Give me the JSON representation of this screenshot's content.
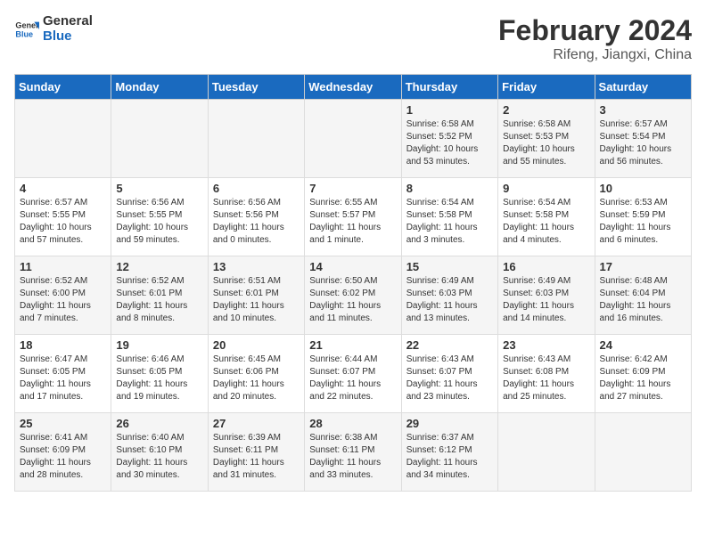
{
  "logo": {
    "line1": "General",
    "line2": "Blue"
  },
  "title": "February 2024",
  "subtitle": "Rifeng, Jiangxi, China",
  "days_of_week": [
    "Sunday",
    "Monday",
    "Tuesday",
    "Wednesday",
    "Thursday",
    "Friday",
    "Saturday"
  ],
  "weeks": [
    [
      {
        "day": "",
        "info": ""
      },
      {
        "day": "",
        "info": ""
      },
      {
        "day": "",
        "info": ""
      },
      {
        "day": "",
        "info": ""
      },
      {
        "day": "1",
        "info": "Sunrise: 6:58 AM\nSunset: 5:52 PM\nDaylight: 10 hours and 53 minutes."
      },
      {
        "day": "2",
        "info": "Sunrise: 6:58 AM\nSunset: 5:53 PM\nDaylight: 10 hours and 55 minutes."
      },
      {
        "day": "3",
        "info": "Sunrise: 6:57 AM\nSunset: 5:54 PM\nDaylight: 10 hours and 56 minutes."
      }
    ],
    [
      {
        "day": "4",
        "info": "Sunrise: 6:57 AM\nSunset: 5:55 PM\nDaylight: 10 hours and 57 minutes."
      },
      {
        "day": "5",
        "info": "Sunrise: 6:56 AM\nSunset: 5:55 PM\nDaylight: 10 hours and 59 minutes."
      },
      {
        "day": "6",
        "info": "Sunrise: 6:56 AM\nSunset: 5:56 PM\nDaylight: 11 hours and 0 minutes."
      },
      {
        "day": "7",
        "info": "Sunrise: 6:55 AM\nSunset: 5:57 PM\nDaylight: 11 hours and 1 minute."
      },
      {
        "day": "8",
        "info": "Sunrise: 6:54 AM\nSunset: 5:58 PM\nDaylight: 11 hours and 3 minutes."
      },
      {
        "day": "9",
        "info": "Sunrise: 6:54 AM\nSunset: 5:58 PM\nDaylight: 11 hours and 4 minutes."
      },
      {
        "day": "10",
        "info": "Sunrise: 6:53 AM\nSunset: 5:59 PM\nDaylight: 11 hours and 6 minutes."
      }
    ],
    [
      {
        "day": "11",
        "info": "Sunrise: 6:52 AM\nSunset: 6:00 PM\nDaylight: 11 hours and 7 minutes."
      },
      {
        "day": "12",
        "info": "Sunrise: 6:52 AM\nSunset: 6:01 PM\nDaylight: 11 hours and 8 minutes."
      },
      {
        "day": "13",
        "info": "Sunrise: 6:51 AM\nSunset: 6:01 PM\nDaylight: 11 hours and 10 minutes."
      },
      {
        "day": "14",
        "info": "Sunrise: 6:50 AM\nSunset: 6:02 PM\nDaylight: 11 hours and 11 minutes."
      },
      {
        "day": "15",
        "info": "Sunrise: 6:49 AM\nSunset: 6:03 PM\nDaylight: 11 hours and 13 minutes."
      },
      {
        "day": "16",
        "info": "Sunrise: 6:49 AM\nSunset: 6:03 PM\nDaylight: 11 hours and 14 minutes."
      },
      {
        "day": "17",
        "info": "Sunrise: 6:48 AM\nSunset: 6:04 PM\nDaylight: 11 hours and 16 minutes."
      }
    ],
    [
      {
        "day": "18",
        "info": "Sunrise: 6:47 AM\nSunset: 6:05 PM\nDaylight: 11 hours and 17 minutes."
      },
      {
        "day": "19",
        "info": "Sunrise: 6:46 AM\nSunset: 6:05 PM\nDaylight: 11 hours and 19 minutes."
      },
      {
        "day": "20",
        "info": "Sunrise: 6:45 AM\nSunset: 6:06 PM\nDaylight: 11 hours and 20 minutes."
      },
      {
        "day": "21",
        "info": "Sunrise: 6:44 AM\nSunset: 6:07 PM\nDaylight: 11 hours and 22 minutes."
      },
      {
        "day": "22",
        "info": "Sunrise: 6:43 AM\nSunset: 6:07 PM\nDaylight: 11 hours and 23 minutes."
      },
      {
        "day": "23",
        "info": "Sunrise: 6:43 AM\nSunset: 6:08 PM\nDaylight: 11 hours and 25 minutes."
      },
      {
        "day": "24",
        "info": "Sunrise: 6:42 AM\nSunset: 6:09 PM\nDaylight: 11 hours and 27 minutes."
      }
    ],
    [
      {
        "day": "25",
        "info": "Sunrise: 6:41 AM\nSunset: 6:09 PM\nDaylight: 11 hours and 28 minutes."
      },
      {
        "day": "26",
        "info": "Sunrise: 6:40 AM\nSunset: 6:10 PM\nDaylight: 11 hours and 30 minutes."
      },
      {
        "day": "27",
        "info": "Sunrise: 6:39 AM\nSunset: 6:11 PM\nDaylight: 11 hours and 31 minutes."
      },
      {
        "day": "28",
        "info": "Sunrise: 6:38 AM\nSunset: 6:11 PM\nDaylight: 11 hours and 33 minutes."
      },
      {
        "day": "29",
        "info": "Sunrise: 6:37 AM\nSunset: 6:12 PM\nDaylight: 11 hours and 34 minutes."
      },
      {
        "day": "",
        "info": ""
      },
      {
        "day": "",
        "info": ""
      }
    ]
  ]
}
